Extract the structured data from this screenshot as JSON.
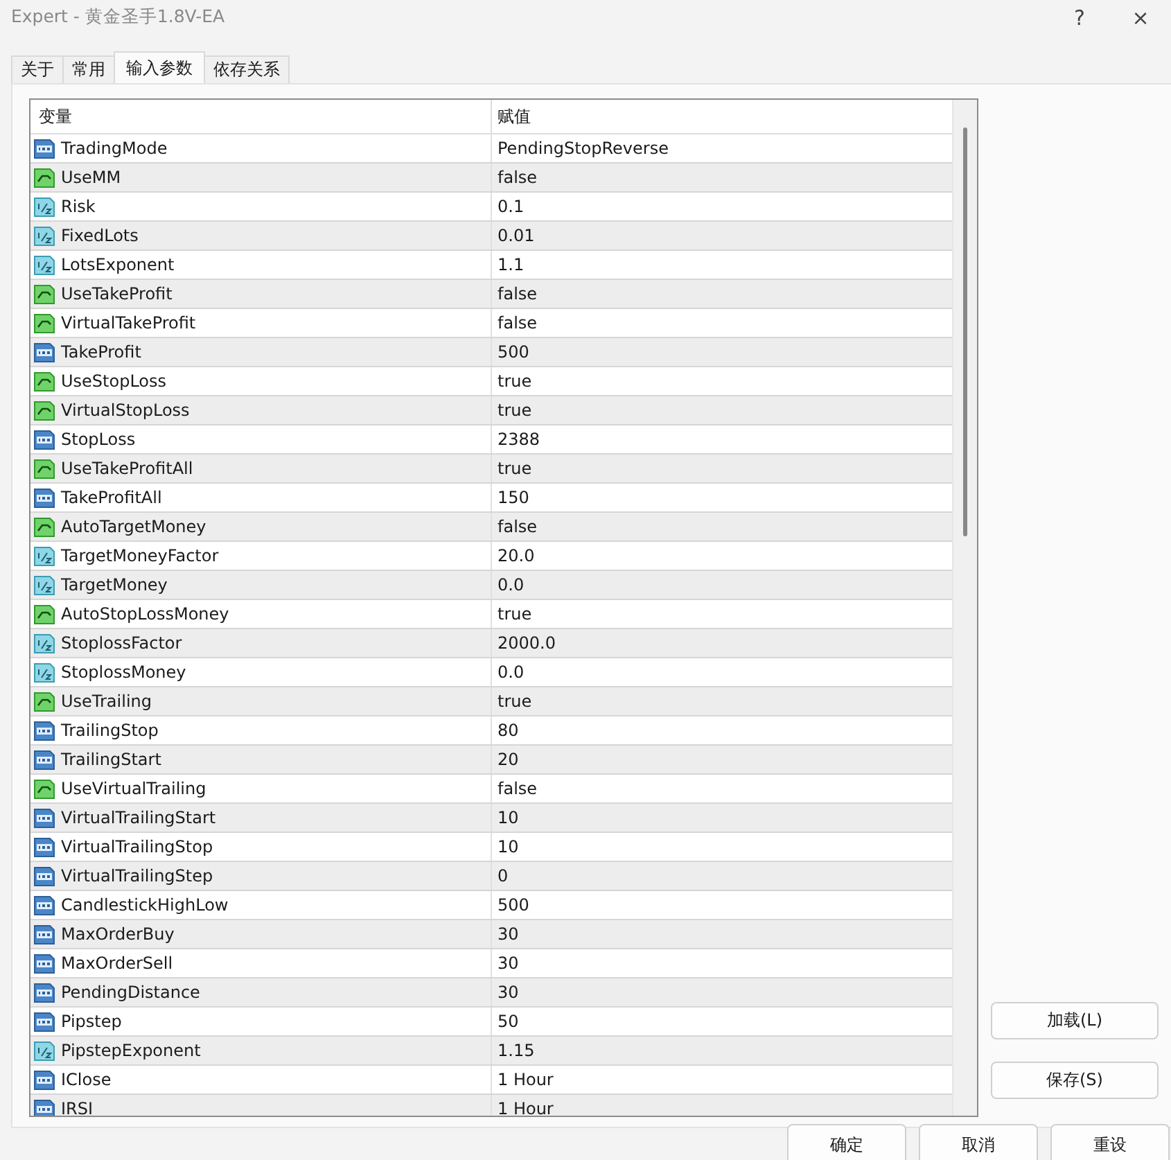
{
  "window": {
    "title": "Expert - 黄金圣手1.8V-EA",
    "help": "?",
    "close": "×"
  },
  "tabs": [
    {
      "label": "关于",
      "selected": false
    },
    {
      "label": "常用",
      "selected": false
    },
    {
      "label": "输入参数",
      "selected": true
    },
    {
      "label": "依存关系",
      "selected": false
    }
  ],
  "table": {
    "columns": [
      "变量",
      "赋值"
    ],
    "rows": [
      {
        "kind": "int",
        "name": "TradingMode",
        "value": "PendingStopReverse"
      },
      {
        "kind": "bool",
        "name": "UseMM",
        "value": "false"
      },
      {
        "kind": "double",
        "name": "Risk",
        "value": "0.1"
      },
      {
        "kind": "double",
        "name": "FixedLots",
        "value": "0.01"
      },
      {
        "kind": "double",
        "name": "LotsExponent",
        "value": "1.1"
      },
      {
        "kind": "bool",
        "name": "UseTakeProfit",
        "value": "false"
      },
      {
        "kind": "bool",
        "name": "VirtualTakeProfit",
        "value": "false"
      },
      {
        "kind": "int",
        "name": "TakeProfit",
        "value": "500"
      },
      {
        "kind": "bool",
        "name": "UseStopLoss",
        "value": "true"
      },
      {
        "kind": "bool",
        "name": "VirtualStopLoss",
        "value": "true"
      },
      {
        "kind": "int",
        "name": "StopLoss",
        "value": "2388"
      },
      {
        "kind": "bool",
        "name": "UseTakeProfitAll",
        "value": "true"
      },
      {
        "kind": "int",
        "name": "TakeProfitAll",
        "value": "150"
      },
      {
        "kind": "bool",
        "name": "AutoTargetMoney",
        "value": "false"
      },
      {
        "kind": "double",
        "name": "TargetMoneyFactor",
        "value": "20.0"
      },
      {
        "kind": "double",
        "name": "TargetMoney",
        "value": "0.0"
      },
      {
        "kind": "bool",
        "name": "AutoStopLossMoney",
        "value": "true"
      },
      {
        "kind": "double",
        "name": "StoplossFactor",
        "value": "2000.0"
      },
      {
        "kind": "double",
        "name": "StoplossMoney",
        "value": "0.0"
      },
      {
        "kind": "bool",
        "name": "UseTrailing",
        "value": "true"
      },
      {
        "kind": "int",
        "name": "TrailingStop",
        "value": "80"
      },
      {
        "kind": "int",
        "name": "TrailingStart",
        "value": "20"
      },
      {
        "kind": "bool",
        "name": "UseVirtualTrailing",
        "value": "false"
      },
      {
        "kind": "int",
        "name": "VirtualTrailingStart",
        "value": "10"
      },
      {
        "kind": "int",
        "name": "VirtualTrailingStop",
        "value": "10"
      },
      {
        "kind": "int",
        "name": "VirtualTrailingStep",
        "value": "0"
      },
      {
        "kind": "int",
        "name": "CandlestickHighLow",
        "value": "500"
      },
      {
        "kind": "int",
        "name": "MaxOrderBuy",
        "value": "30"
      },
      {
        "kind": "int",
        "name": "MaxOrderSell",
        "value": "30"
      },
      {
        "kind": "int",
        "name": "PendingDistance",
        "value": "30"
      },
      {
        "kind": "int",
        "name": "Pipstep",
        "value": "50"
      },
      {
        "kind": "double",
        "name": "PipstepExponent",
        "value": "1.15"
      },
      {
        "kind": "int",
        "name": "IClose",
        "value": "1 Hour"
      },
      {
        "kind": "int",
        "name": "IRSI",
        "value": "1 Hour"
      }
    ]
  },
  "side_buttons": [
    "加载(L)",
    "保存(S)"
  ],
  "bottom_buttons": [
    "确定",
    "取消",
    "重设"
  ]
}
